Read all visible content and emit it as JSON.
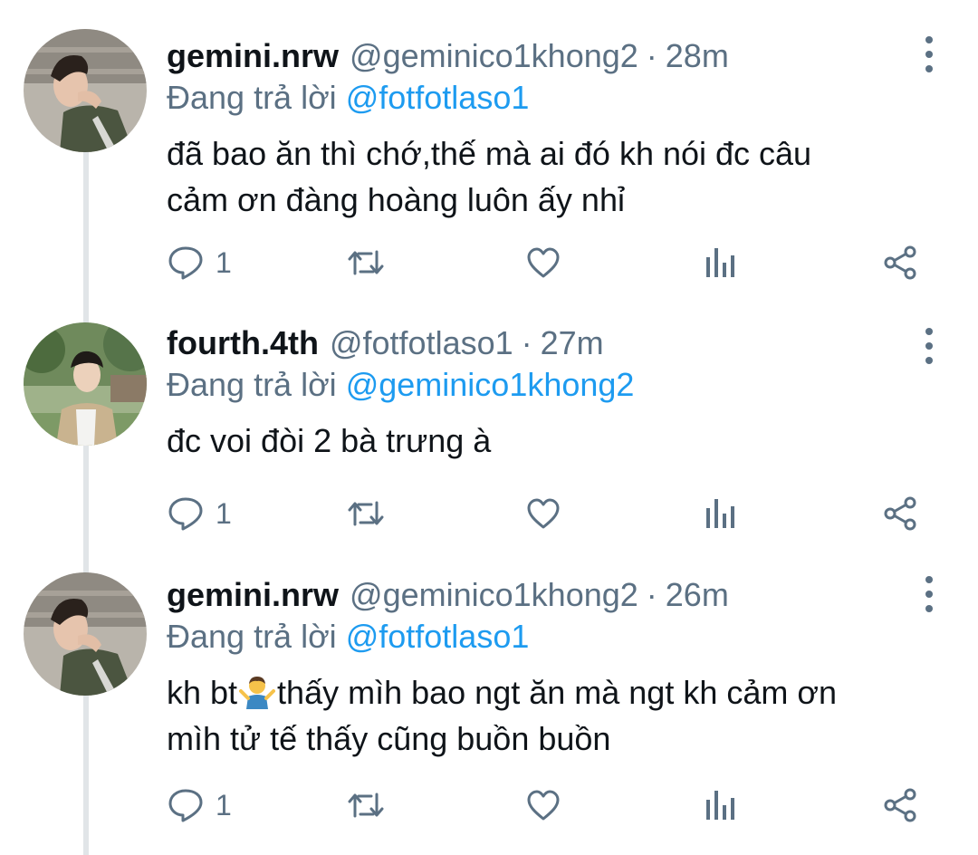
{
  "reply_prefix": "Đang trả lời",
  "tweets": [
    {
      "name": "gemini.nrw",
      "handle": "@geminico1khong2",
      "separator": "·",
      "time": "28m",
      "reply_to": "@fotfotlaso1",
      "line1": "đã bao ăn thì chớ,thế mà ai đó kh nói đc câu",
      "line2": "cảm ơn đàng hoàng luôn ấy nhỉ",
      "reply_count": "1"
    },
    {
      "name": "fourth.4th",
      "handle": "@fotfotlaso1",
      "separator": "·",
      "time": "27m",
      "reply_to": "@geminico1khong2",
      "line1": "đc voi đòi 2 bà trưng à",
      "reply_count": "1"
    },
    {
      "name": "gemini.nrw",
      "handle": "@geminico1khong2",
      "separator": "·",
      "time": "26m",
      "reply_to": "@fotfotlaso1",
      "line1_a": "kh bt",
      "emoji": "person-shrugging-emoji",
      "line1_b": "thấy mìh bao ngt ăn mà ngt kh cảm ơn",
      "line2": "mìh tử tế thấy cũng buồn buồn",
      "reply_count": "1"
    }
  ],
  "icons": {
    "reply": "comment-icon",
    "retweet": "retweet-icon",
    "like": "heart-icon",
    "analytics": "analytics-icon",
    "share": "share-icon",
    "more": "more-vertical-icon"
  },
  "colors": {
    "text": "#0f1419",
    "secondary": "#5b7083",
    "link": "#1d9bf0",
    "thread_line": "#e1e5e8"
  }
}
